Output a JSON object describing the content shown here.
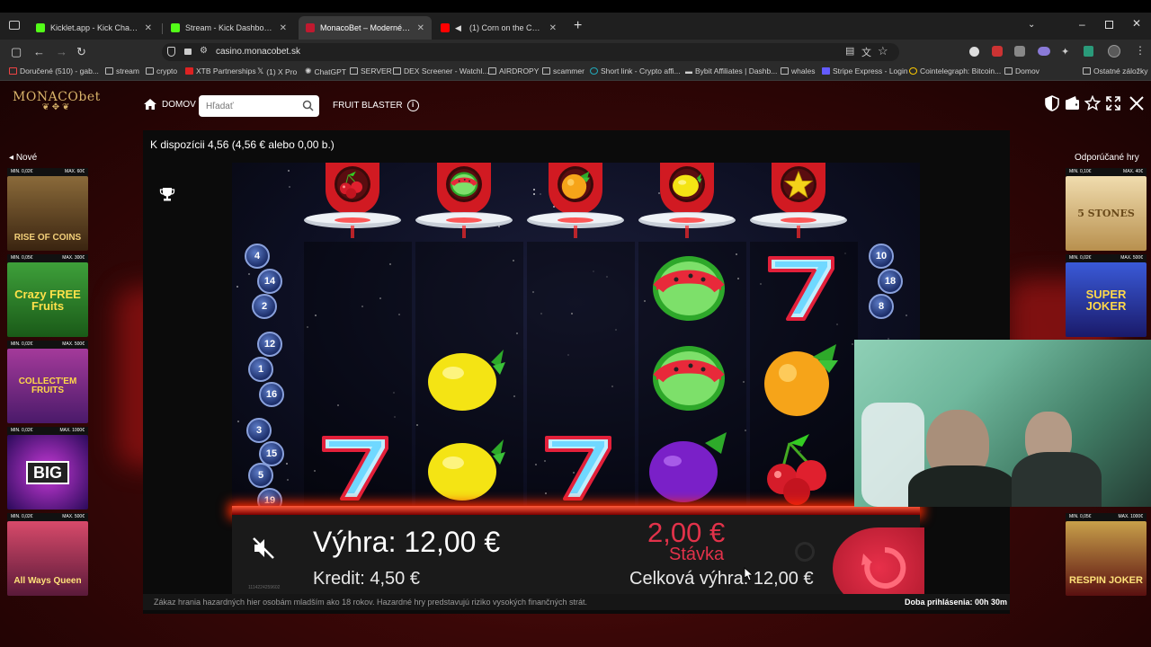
{
  "browser": {
    "tabs": [
      {
        "label": "Kicklet.app - Kick Chatbot and",
        "fav": "#53fc18",
        "active": false
      },
      {
        "label": "Stream - Kick Dashboard",
        "fav": "#53fc18",
        "active": false
      },
      {
        "label": "MonacoBet – Moderné Online",
        "fav": "#c0192f",
        "active": true
      },
      {
        "label": "(1) Corn on the Curb - You",
        "fav": "#ff0000",
        "active": false
      }
    ],
    "url": "casino.monacobet.sk",
    "bookmarks": [
      "Doručené (510) - gab...",
      "stream",
      "crypto",
      "XTB Partnerships",
      "(1) X Pro",
      "ChatGPT",
      "SERVER",
      "DEX Screener - Watchl...",
      "AIRDROPY",
      "scammer",
      "Short link - Crypto affi...",
      "Bybit Affiliates | Dashb...",
      "whales",
      "Stripe Express - Login",
      "Cointelegraph: Bitcoin...",
      "Domov",
      "Ostatné záložky"
    ]
  },
  "site": {
    "logo": "MONACObet",
    "nav_home": "DOMOV",
    "search_placeholder": "Hľadať",
    "game_title": "FRUIT BLASTER",
    "balance": "K dispozícii 4,56 (4,56 € alebo 0,00 b.)",
    "left_sidebar_title": "Nové",
    "right_sidebar_title": "Odporúčané hry",
    "left_games": [
      {
        "min": "MIN. 0,02€",
        "max": "MAX. 60€",
        "name": "RISE OF COINS",
        "color": "#6b4a1e"
      },
      {
        "min": "MIN. 0,05€",
        "max": "MAX. 300€",
        "name": "Crazy FREE Fruits",
        "color": "#3a8b2a"
      },
      {
        "min": "MIN. 0,02€",
        "max": "MAX. 500€",
        "name": "COLLECT'EM FRUITS",
        "color": "#7a2a7a"
      },
      {
        "min": "MIN. 0,02€",
        "max": "MAX. 1000€",
        "name": "BIG",
        "color": "#4b1a7a"
      },
      {
        "min": "MIN. 0,02€",
        "max": "MAX. 500€",
        "name": "All Ways Queen",
        "color": "#8a2a4a"
      }
    ],
    "right_games": [
      {
        "min": "MIN. 0,10€",
        "max": "MAX. 40€",
        "name": "5 STONES",
        "color": "#c9a05a"
      },
      {
        "min": "MIN. 0,02€",
        "max": "MAX. 500€",
        "name": "SUPER JOKER",
        "color": "#2a3a9a"
      },
      {
        "min": "MIN. 0,05€",
        "max": "MAX. 1000€",
        "name": "RESPIN JOKER",
        "color": "#8a1a1a"
      }
    ],
    "disclaimer": "Zákaz hrania hazardných hier osobám mladším ako 18 rokov. Hazardné hry predstavujú riziko vysokých finančných strát.",
    "session": "Doba prihlásenia: 00h 30m"
  },
  "game": {
    "win_label": "Výhra:",
    "win_value": "12,00 €",
    "credit_label": "Kredit:",
    "credit_value": "4,50 €",
    "stake_value": "2,00 €",
    "stake_label": "Stávka",
    "total_win_label": "Celková výhra:",
    "total_win_value": "12,00 €",
    "game_id": "1114224259602",
    "line_badges_left": [
      "4",
      "14",
      "2",
      "12",
      "1",
      "16",
      "3",
      "15",
      "5",
      "19"
    ],
    "line_badges_right": [
      "10",
      "18",
      "8"
    ],
    "ufo_symbols": [
      "cherry",
      "watermelon",
      "orange",
      "lemon",
      "star"
    ],
    "reels": [
      [
        "empty",
        "empty",
        "seven"
      ],
      [
        "empty",
        "lemon",
        "lemon"
      ],
      [
        "empty",
        "empty",
        "seven"
      ],
      [
        "watermelon",
        "watermelon",
        "plum"
      ],
      [
        "seven",
        "orange",
        "cherry"
      ]
    ]
  }
}
